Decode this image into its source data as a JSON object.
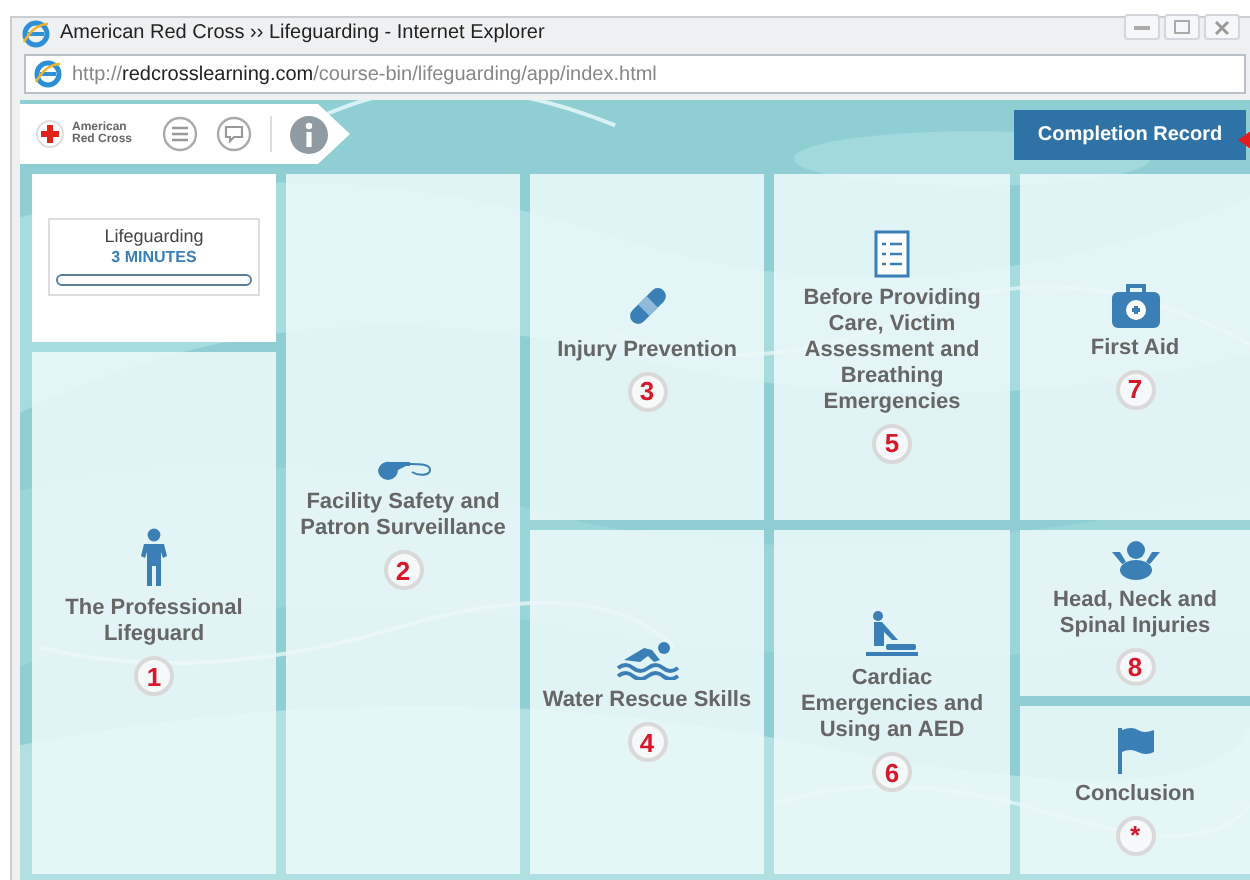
{
  "window": {
    "title": "American Red Cross ›› Lifeguarding - Internet Explorer"
  },
  "address_bar": {
    "url": "http://**redcrosslearning.com**/course-bin/lifeguarding/app/index.html"
  },
  "toolbar": {
    "logo_text": "American Red Cross",
    "button": "Completion Record"
  },
  "timer": {
    "course": "Lifeguarding",
    "duration": "3 MINUTES",
    "level": 0
  },
  "modules": [
    {
      "title": "The Professional Lifeguard",
      "number": "1"
    },
    {
      "title": "Facility Safety and Patron Surveillance",
      "number": "2"
    },
    {
      "title": "Injury Prevention",
      "number": "3"
    },
    {
      "title": "Water Rescue Skills",
      "number": "4"
    },
    {
      "title": "Before Providing Care, Victim Assessment and Breathing Emergencies",
      "number": "5"
    },
    {
      "title": "Cardiac Emergencies and Using an AED",
      "number": "6"
    },
    {
      "title": "First Aid",
      "number": "7"
    },
    {
      "title": "Head, Neck and Spinal Injuries",
      "number": "8"
    },
    {
      "title": "Conclusion",
      "number": "*"
    }
  ]
}
